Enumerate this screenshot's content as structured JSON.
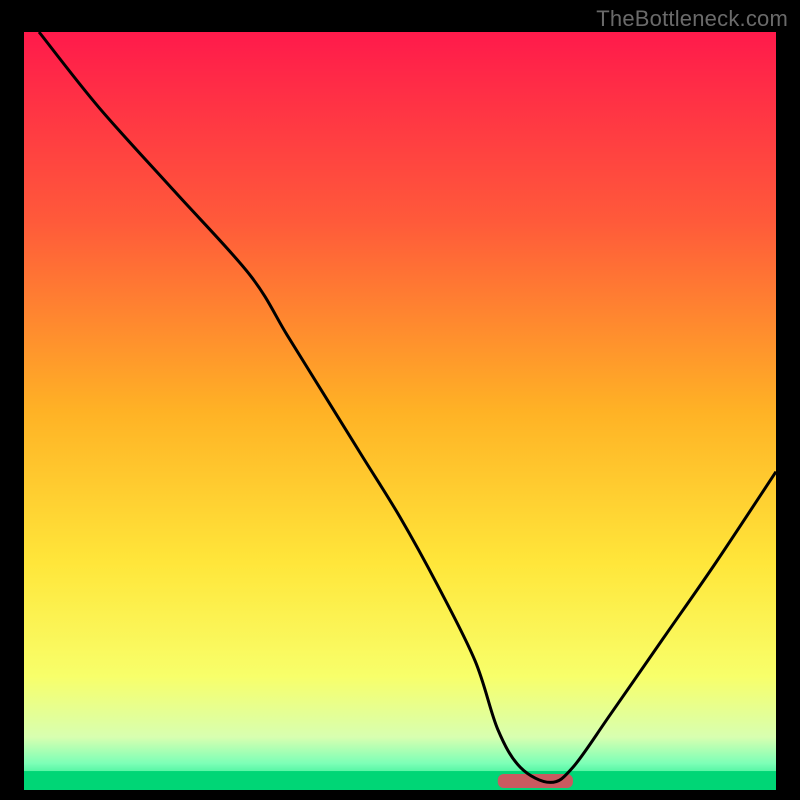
{
  "watermark": "TheBottleneck.com",
  "chart_data": {
    "type": "line",
    "title": "",
    "xlabel": "",
    "ylabel": "",
    "xlim": [
      0,
      100
    ],
    "ylim": [
      0,
      100
    ],
    "grid": false,
    "legend": false,
    "background_gradient_stops": [
      {
        "pos": 0.0,
        "color": "#ff1a4b"
      },
      {
        "pos": 0.25,
        "color": "#ff5a3a"
      },
      {
        "pos": 0.5,
        "color": "#ffb225"
      },
      {
        "pos": 0.7,
        "color": "#ffe63a"
      },
      {
        "pos": 0.85,
        "color": "#f8ff6a"
      },
      {
        "pos": 0.93,
        "color": "#d8ffb0"
      },
      {
        "pos": 0.965,
        "color": "#7cffb7"
      },
      {
        "pos": 1.0,
        "color": "#00e07a"
      }
    ],
    "optimum_band": {
      "x_start": 63,
      "x_end": 73,
      "color": "#c95a60"
    },
    "series": [
      {
        "name": "bottleneck-curve",
        "color": "#000000",
        "x": [
          2,
          10,
          20,
          30,
          35,
          40,
          45,
          50,
          55,
          60,
          63,
          66,
          70,
          73,
          78,
          85,
          92,
          100
        ],
        "y": [
          100,
          90,
          79,
          68,
          60,
          52,
          44,
          36,
          27,
          17,
          8,
          3,
          1,
          3,
          10,
          20,
          30,
          42
        ]
      }
    ]
  }
}
